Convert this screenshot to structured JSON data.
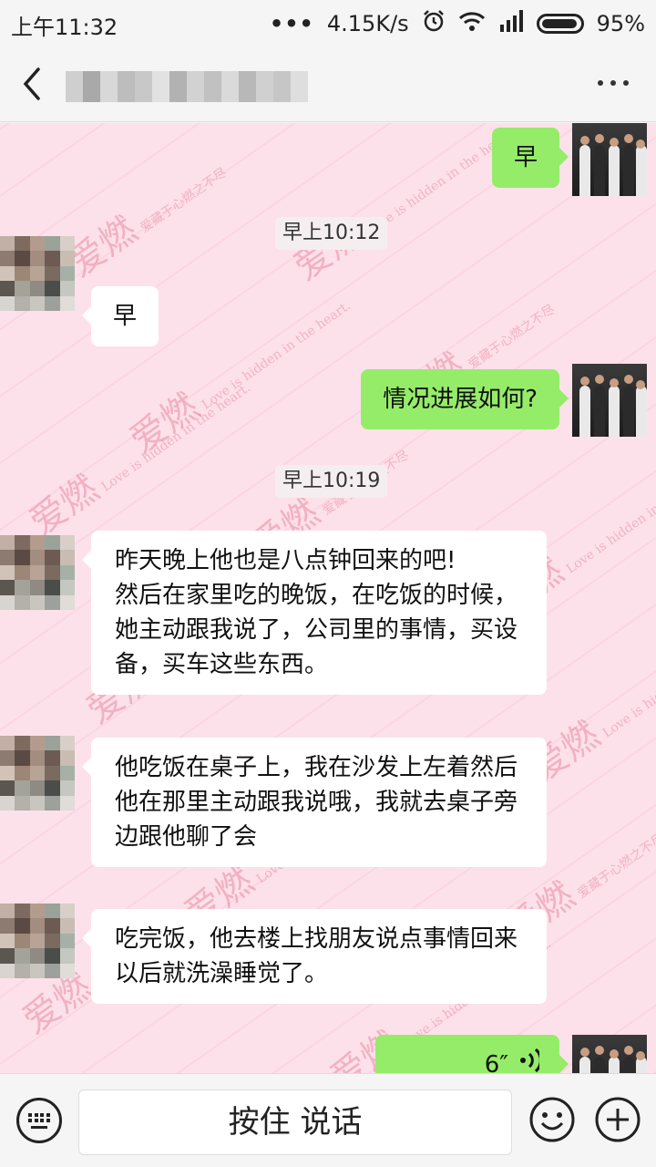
{
  "status_bar": {
    "time": "上午11:32",
    "network_speed": "4.15K/s",
    "battery": "95%",
    "icons": [
      "dots-icon",
      "alarm-icon",
      "wifi-icon",
      "signal-icon",
      "battery-icon"
    ]
  },
  "header": {
    "contact_name_blurred": true,
    "back_icon": "chevron-left-icon",
    "more_icon": "more-dots-icon"
  },
  "watermark": {
    "main": "爱燃",
    "sub": "爱藏于心燃之不尽",
    "en": "Love is hidden in the heart."
  },
  "messages": [
    {
      "side": "out",
      "text": "早"
    },
    {
      "type": "timestamp",
      "text": "早上10:12"
    },
    {
      "side": "in",
      "text": "早"
    },
    {
      "side": "out",
      "text": "情况进展如何?"
    },
    {
      "type": "timestamp",
      "text": "早上10:19"
    },
    {
      "side": "in",
      "text": "昨天晚上他也是八点钟回来的吧!\n然后在家里吃的晚饭，在吃饭的时候，她主动跟我说了，公司里的事情，买设备，买车这些东西。"
    },
    {
      "side": "in",
      "text": "他吃饭在桌子上，我在沙发上左着然后他在那里主动跟我说哦，我就去桌子旁边跟他聊了会"
    },
    {
      "side": "in",
      "text": "吃完饭，他去楼上找朋友说点事情回来以后就洗澡睡觉了。"
    },
    {
      "side": "out",
      "type": "voice",
      "duration": "6″"
    }
  ],
  "input_bar": {
    "hold_to_talk": "按住 说话",
    "keyboard_icon": "keyboard-icon",
    "emoji_icon": "emoji-icon",
    "plus_icon": "plus-icon"
  },
  "colors": {
    "chat_background": "#fde1ea",
    "outgoing_bubble": "#95ec69",
    "incoming_bubble": "#ffffff",
    "watermark": "#dc5a78"
  }
}
